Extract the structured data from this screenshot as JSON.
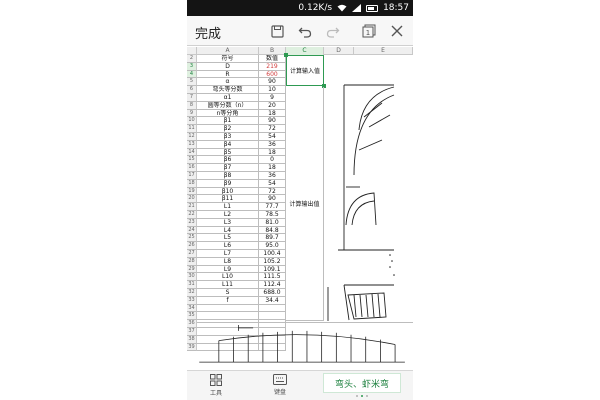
{
  "statusbar": {
    "speed": "0.12K/s",
    "time": "18:57"
  },
  "toolbar": {
    "done_label": "完成",
    "sheet_count": "1"
  },
  "columns": [
    "A",
    "B",
    "C",
    "D",
    "E"
  ],
  "rows": [
    {
      "num": "2",
      "a": "符号",
      "b": "数值"
    },
    {
      "num": "3",
      "a": "D",
      "b": "219",
      "red": true
    },
    {
      "num": "4",
      "a": "R",
      "b": "600",
      "red": true
    },
    {
      "num": "5",
      "a": "α",
      "b": "90"
    },
    {
      "num": "6",
      "a": "弯头等分数",
      "b": "10"
    },
    {
      "num": "7",
      "a": "α1",
      "b": "9"
    },
    {
      "num": "8",
      "a": "圆等分数（n）",
      "b": "20"
    },
    {
      "num": "9",
      "a": "n等分角",
      "b": "18"
    },
    {
      "num": "10",
      "a": "β1",
      "b": "90"
    },
    {
      "num": "11",
      "a": "β2",
      "b": "72"
    },
    {
      "num": "12",
      "a": "β3",
      "b": "54"
    },
    {
      "num": "13",
      "a": "β4",
      "b": "36"
    },
    {
      "num": "14",
      "a": "β5",
      "b": "18"
    },
    {
      "num": "15",
      "a": "β6",
      "b": "0"
    },
    {
      "num": "16",
      "a": "β7",
      "b": "18"
    },
    {
      "num": "17",
      "a": "β8",
      "b": "36"
    },
    {
      "num": "18",
      "a": "β9",
      "b": "54"
    },
    {
      "num": "19",
      "a": "β10",
      "b": "72"
    },
    {
      "num": "20",
      "a": "β11",
      "b": "90"
    },
    {
      "num": "21",
      "a": "L1",
      "b": "77.7"
    },
    {
      "num": "22",
      "a": "L2",
      "b": "78.5"
    },
    {
      "num": "23",
      "a": "L3",
      "b": "81.0"
    },
    {
      "num": "24",
      "a": "L4",
      "b": "84.8"
    },
    {
      "num": "25",
      "a": "L5",
      "b": "89.7"
    },
    {
      "num": "26",
      "a": "L6",
      "b": "95.0"
    },
    {
      "num": "27",
      "a": "L7",
      "b": "100.4"
    },
    {
      "num": "28",
      "a": "L8",
      "b": "105.2"
    },
    {
      "num": "29",
      "a": "L9",
      "b": "109.1"
    },
    {
      "num": "30",
      "a": "L10",
      "b": "111.5"
    },
    {
      "num": "31",
      "a": "L11",
      "b": "112.4"
    },
    {
      "num": "32",
      "a": "S",
      "b": "688.0"
    },
    {
      "num": "33",
      "a": "f",
      "b": "34.4"
    },
    {
      "num": "34",
      "a": "",
      "b": ""
    },
    {
      "num": "35",
      "a": "",
      "b": ""
    },
    {
      "num": "36",
      "a": "",
      "b": ""
    },
    {
      "num": "37",
      "a": "",
      "b": ""
    },
    {
      "num": "38",
      "a": "",
      "b": ""
    },
    {
      "num": "39",
      "a": "",
      "b": ""
    }
  ],
  "merged": {
    "input_label": "计算输入值",
    "output_label": "计算输出值"
  },
  "bottombar": {
    "tools_label": "工具",
    "keyboard_label": "键盘",
    "sheet_tab_label": "弯头、虾米弯"
  },
  "colors": {
    "accent": "#2e9a52",
    "value_red": "#d23c3c"
  }
}
